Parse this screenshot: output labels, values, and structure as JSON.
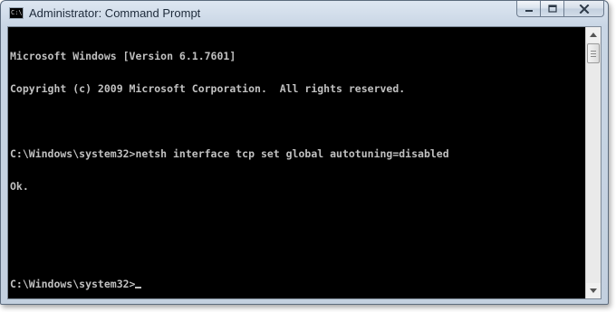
{
  "window": {
    "title": "Administrator: Command Prompt",
    "icon": "cmd-console-icon",
    "icon_text": "C:\\",
    "buttons": {
      "minimize_icon": "minimize-icon",
      "maximize_icon": "maximize-icon",
      "close_icon": "close-icon"
    }
  },
  "console": {
    "lines": [
      "Microsoft Windows [Version 6.1.7601]",
      "Copyright (c) 2009 Microsoft Corporation.  All rights reserved.",
      "",
      "C:\\Windows\\system32>netsh interface tcp set global autotuning=disabled",
      "Ok.",
      "",
      "",
      "C:\\Windows\\system32>"
    ],
    "cursor_line_index": 7
  },
  "scrollbar": {
    "up_icon": "arrow-up-icon",
    "down_icon": "arrow-down-icon"
  },
  "colors": {
    "console_background": "#000000",
    "console_text": "#c0c0c0",
    "titlebar": "#c9d6e5"
  }
}
